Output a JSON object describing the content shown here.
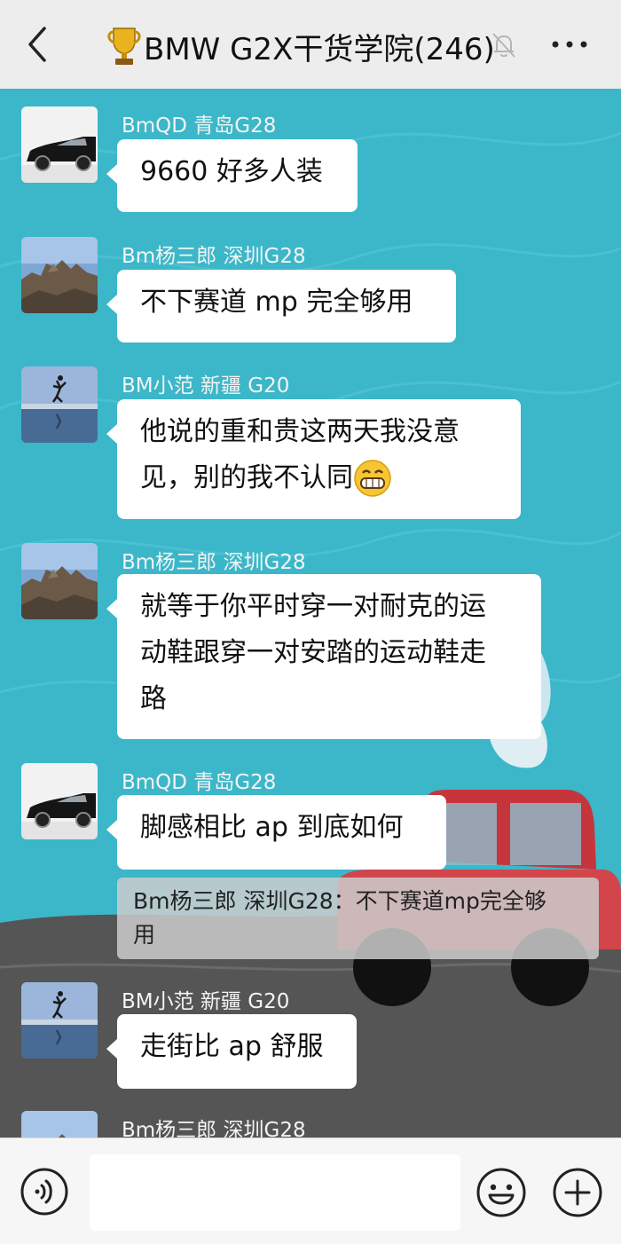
{
  "header": {
    "title": "BMW G2X干货学院(246)",
    "trophy_icon": "trophy-icon"
  },
  "messages": [
    {
      "sender": "BmQD 青岛G28",
      "lines": [
        "9660 好多人装"
      ],
      "avatar": "black-car"
    },
    {
      "sender": "Bm杨三郎 深圳G28",
      "lines": [
        "不下赛道 mp 完全够用"
      ],
      "avatar": "rocky-cliff"
    },
    {
      "sender": "BM小范 新疆 G20",
      "lines": [
        "他说的重和贵这两天我没意",
        "见，别的我不认同"
      ],
      "avatar": "lake-jump",
      "emoji": "grinning-face-icon"
    },
    {
      "sender": "Bm杨三郎 深圳G28",
      "lines": [
        "就等于你平时穿一对耐克的运",
        "动鞋跟穿一对安踏的运动鞋走",
        "路"
      ],
      "avatar": "rocky-cliff"
    },
    {
      "sender": "BmQD 青岛G28",
      "lines": [
        "脚感相比 ap 到底如何"
      ],
      "avatar": "black-car"
    },
    {
      "sender": "BM小范 新疆 G20",
      "lines": [
        "走街比 ap 舒服"
      ],
      "avatar": "lake-jump"
    },
    {
      "sender": "Bm杨三郎 深圳G28",
      "lines": [],
      "avatar": "rocky-cliff"
    }
  ],
  "quote": {
    "text_line1": "Bm杨三郎 深圳G28：不下赛道mp完全够",
    "text_line2": "用"
  },
  "footer": {
    "input_value": ""
  },
  "colors": {
    "chat_bg": "#3bb7c9",
    "header_bg": "#ededed",
    "bubble": "#ffffff"
  }
}
